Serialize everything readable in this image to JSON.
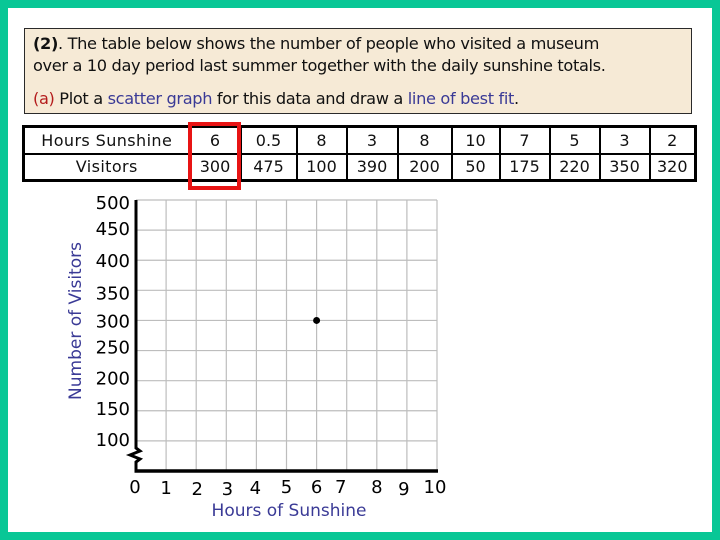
{
  "colors": {
    "frame": "#08c796",
    "panel": "#ffffff",
    "question_bg": "#f6ead6",
    "part_label": "#b41c1c",
    "keyword": "#3a3a96",
    "highlight": "#e81414",
    "grid": "#bdbdbd",
    "point": "#000000"
  },
  "question": {
    "number": "(2)",
    "line1_rest": ". The table below shows the number of people who visited a museum",
    "line2": "over a 10 day period last summer together with the daily sunshine totals.",
    "part_label": "(a)",
    "part_text1": " Plot a ",
    "part_kw1": "scatter graph",
    "part_text2": " for this data and draw a ",
    "part_kw2": "line of best fit",
    "part_text3": "."
  },
  "table": {
    "row_headers": [
      "Hours Sunshine",
      "Visitors"
    ],
    "hours": [
      "6",
      "0.5",
      "8",
      "3",
      "8",
      "10",
      "7",
      "5",
      "3",
      "2"
    ],
    "visitors": [
      "300",
      "475",
      "100",
      "390",
      "200",
      "50",
      "175",
      "220",
      "350",
      "320"
    ],
    "highlighted_column": 0
  },
  "chart_data": {
    "type": "scatter",
    "title": "",
    "xlabel": "Hours of Sunshine",
    "ylabel": "Number of Visitors",
    "xlim": [
      0,
      10
    ],
    "ylim": [
      50,
      500
    ],
    "y_axis_break": true,
    "grid": true,
    "x_ticks": [
      "0",
      "1",
      "2",
      "3",
      "4",
      "5",
      "6",
      "7",
      "8",
      "9",
      "10"
    ],
    "y_ticks": [
      "500",
      "450",
      "400",
      "350",
      "300",
      "250",
      "200",
      "150",
      "100"
    ],
    "points": [
      {
        "x": 6,
        "y": 300
      }
    ],
    "legend": "none"
  }
}
